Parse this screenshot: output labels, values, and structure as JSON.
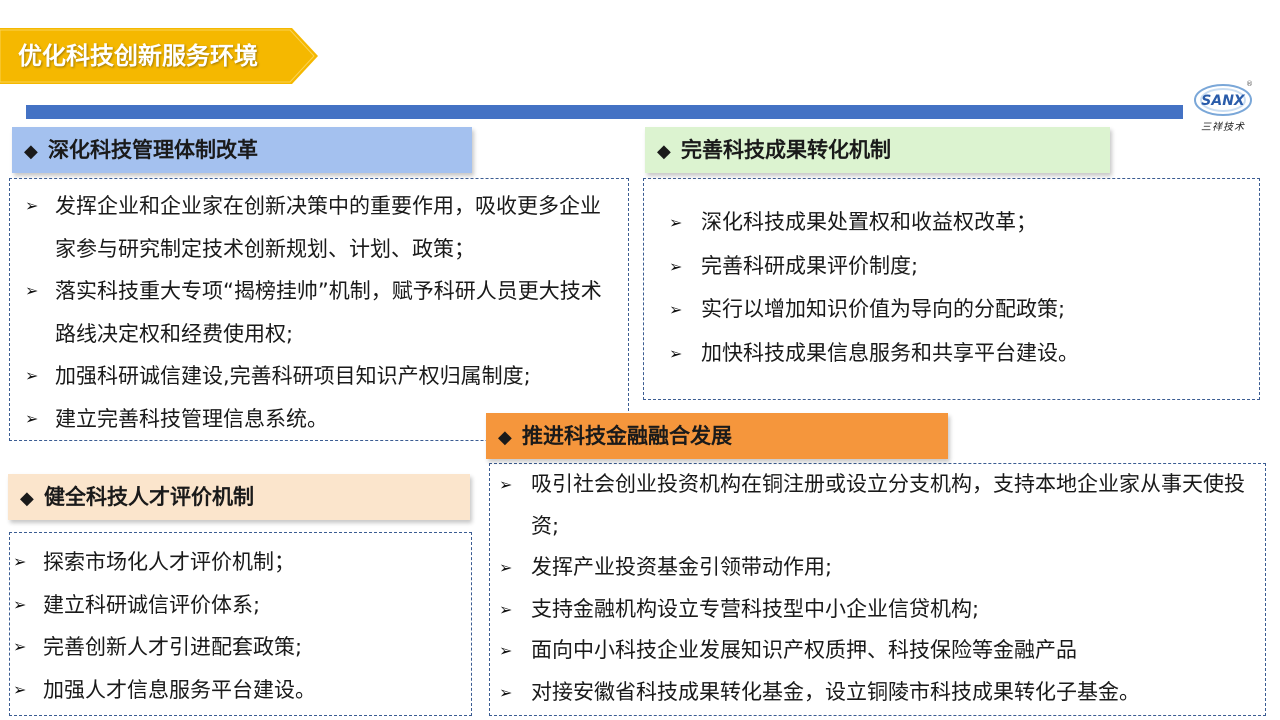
{
  "title": "优化科技创新服务环境",
  "logo": {
    "text": "三祥技术",
    "mark": "®"
  },
  "bullet_glyph": "◆",
  "item_glyph": "➢",
  "colors": {
    "title_banner": "#f5b800",
    "rule": "#4472c4",
    "header_blue": "#a4c1ef",
    "header_green": "#dcf3d0",
    "header_peach": "#fbe5cc",
    "header_orange": "#f5963c",
    "box_border": "#3b5c92"
  },
  "sections": {
    "mgmt": {
      "header": "深化科技管理体制改革",
      "items": [
        "发挥企业和企业家在创新决策中的重要作用，吸收更多企业家参与研究制定技术创新规划、计划、政策；",
        "落实科技重大专项“揭榜挂帅”机制，赋予科研人员更大技术路线决定权和经费使用权;",
        "加强科研诚信建设,完善科研项目知识产权归属制度;",
        "建立完善科技管理信息系统。"
      ]
    },
    "transfer": {
      "header": "完善科技成果转化机制",
      "items": [
        "深化科技成果处置权和收益权改革；",
        "完善科研成果评价制度;",
        "实行以增加知识价值为导向的分配政策;",
        "加快科技成果信息服务和共享平台建设。"
      ]
    },
    "talent": {
      "header": "健全科技人才评价机制",
      "items": [
        "探索市场化人才评价机制；",
        "建立科研诚信评价体系;",
        "完善创新人才引进配套政策;",
        "加强人才信息服务平台建设。"
      ]
    },
    "finance": {
      "header": "推进科技金融融合发展",
      "items": [
        "吸引社会创业投资机构在铜注册或设立分支机构，支持本地企业家从事天使投资;",
        "发挥产业投资基金引领带动作用;",
        "支持金融机构设立专营科技型中小企业信贷机构;",
        "面向中小科技企业发展知识产权质押、科技保险等金融产品",
        "对接安徽省科技成果转化基金，设立铜陵市科技成果转化子基金。"
      ]
    }
  }
}
